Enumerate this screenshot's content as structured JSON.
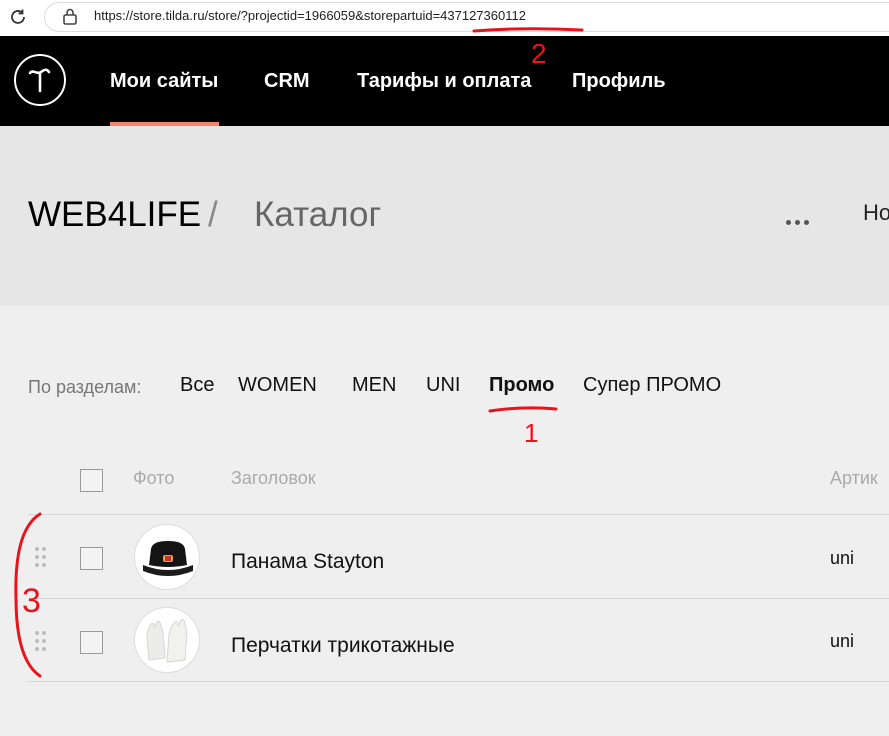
{
  "browser": {
    "url": "https://store.tilda.ru/store/?projectid=1966059&storepartuid=437127360112"
  },
  "nav": {
    "items": [
      "Мои сайты",
      "CRM",
      "Тарифы и оплата",
      "Профиль"
    ],
    "active_color": "#f4846b"
  },
  "page": {
    "project": "WEB4LIFE",
    "separator": "/",
    "title": "Каталог",
    "cut_off_text": "Но"
  },
  "filters": {
    "label": "По разделам:",
    "items": [
      "Все",
      "WOMEN",
      "MEN",
      "UNI",
      "Промо",
      "Супер ПРОМО"
    ],
    "active": "Промо"
  },
  "table": {
    "headers": [
      "Фото",
      "Заголовок",
      "Артик"
    ],
    "rows": [
      {
        "title": "Панама Stayton",
        "sku": "uni",
        "photo": "black-bucket-hat"
      },
      {
        "title": "Перчатки трикотажные",
        "sku": "uni",
        "photo": "white-knit-gloves"
      }
    ]
  },
  "annotations": {
    "color": "#e8141d",
    "marks": [
      "1",
      "2",
      "3"
    ]
  }
}
